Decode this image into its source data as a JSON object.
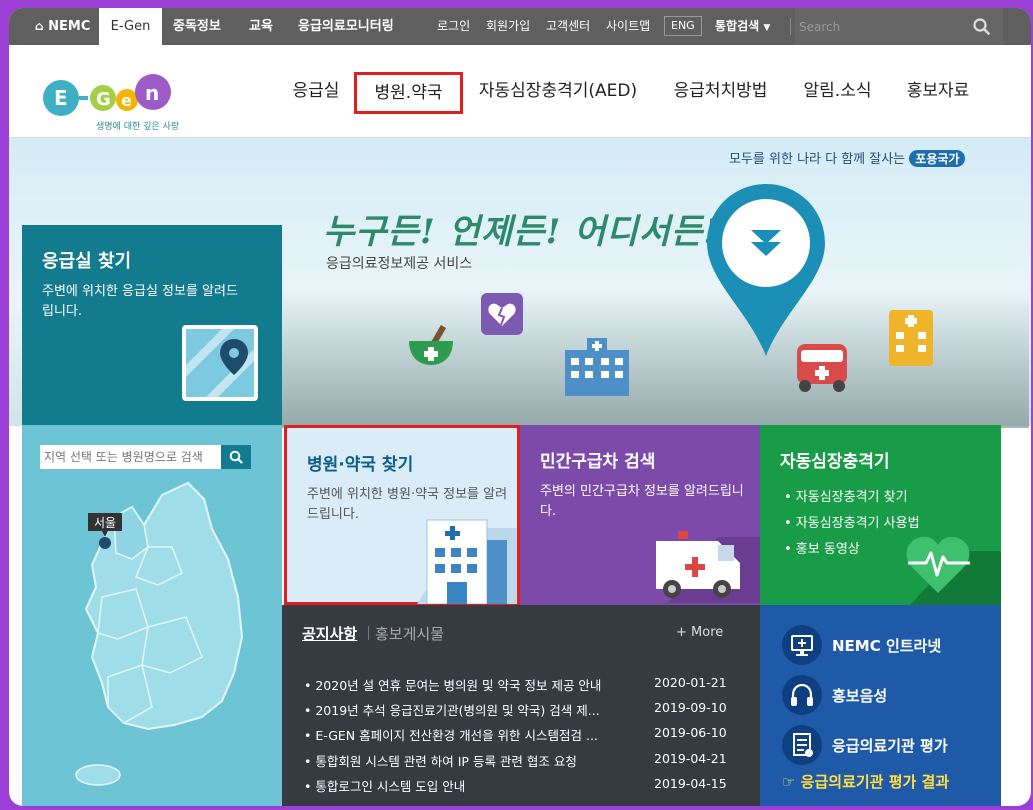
{
  "topbar": {
    "nemc": "NEMC",
    "egen": "E-Gen",
    "addiction": "중독정보",
    "education": "교육",
    "monitoring": "응급의료모니터링",
    "login": "로그인",
    "signup": "회원가입",
    "support": "고객센터",
    "sitemap": "사이트맵",
    "eng": "ENG",
    "integrated_search": "통합검색",
    "search_placeholder": "Search"
  },
  "logo": {
    "text": "E-Gen",
    "tagline": "생명에 대한 깊은 사랑"
  },
  "gnb": [
    "응급실",
    "병원.약국",
    "자동심장충격기(AED)",
    "응급처치방법",
    "알림.소식",
    "홍보자료"
  ],
  "hero": {
    "tagline_prefix": "모두를 위한 나라 다 함께 잘사는",
    "tagline_badge": "포용국가",
    "slogan": "누구든! 언제든! 어디서든!",
    "slogan_sub": "응급의료정보제공 서비스"
  },
  "er_panel": {
    "title": "응급실 찾기",
    "desc": "주변에 위치한 응급실 정보를 알려드립니다."
  },
  "map_panel": {
    "search_placeholder": "지역 선택 또는 병원명으로 검색",
    "seoul_label": "서울"
  },
  "tiles": {
    "hospital": {
      "title": "병원·약국 찾기",
      "desc": "주변에 위치한 병원·약국 정보를 알려드립니다."
    },
    "ambulance": {
      "title": "민간구급차 검색",
      "desc": "주변의 민간구급차 정보를 알려드립니다."
    },
    "aed": {
      "title": "자동심장충격기",
      "items": [
        "• 자동심장충격기 찾기",
        "• 자동심장충격기 사용법",
        "• 홍보 동영상"
      ]
    }
  },
  "notice": {
    "tab_active": "공지사항",
    "tab_other": "홍보게시물",
    "more": "+ More",
    "items": [
      {
        "title": "• 2020년 설 연휴 문여는 병의원 및 약국 정보 제공 안내",
        "date": "2020-01-21"
      },
      {
        "title": "• 2019년 추석 응급진료기관(병의원 및 약국) 검색 제...",
        "date": "2019-09-10"
      },
      {
        "title": "• E-GEN 홈페이지 전산환경 개선을 위한 시스템점검 ...",
        "date": "2019-06-10"
      },
      {
        "title": "• 통합회원 시스템 관련 하여 IP 등록 관련 협조 요청",
        "date": "2019-04-21"
      },
      {
        "title": "• 통합로그인 시스템 도입 안내",
        "date": "2019-04-15"
      }
    ]
  },
  "links": {
    "intranet": "NEMC 인트라넷",
    "audio": "홍보음성",
    "evaluation": "응급의료기관 평가",
    "result": "☞ 응급의료기관 평가 결과"
  },
  "colors": {
    "highlight": "#e02020",
    "er_teal": "#127b8e",
    "ambulance_purple": "#7c4aa8",
    "aed_green": "#189c48",
    "links_blue": "#1f5aa8"
  }
}
